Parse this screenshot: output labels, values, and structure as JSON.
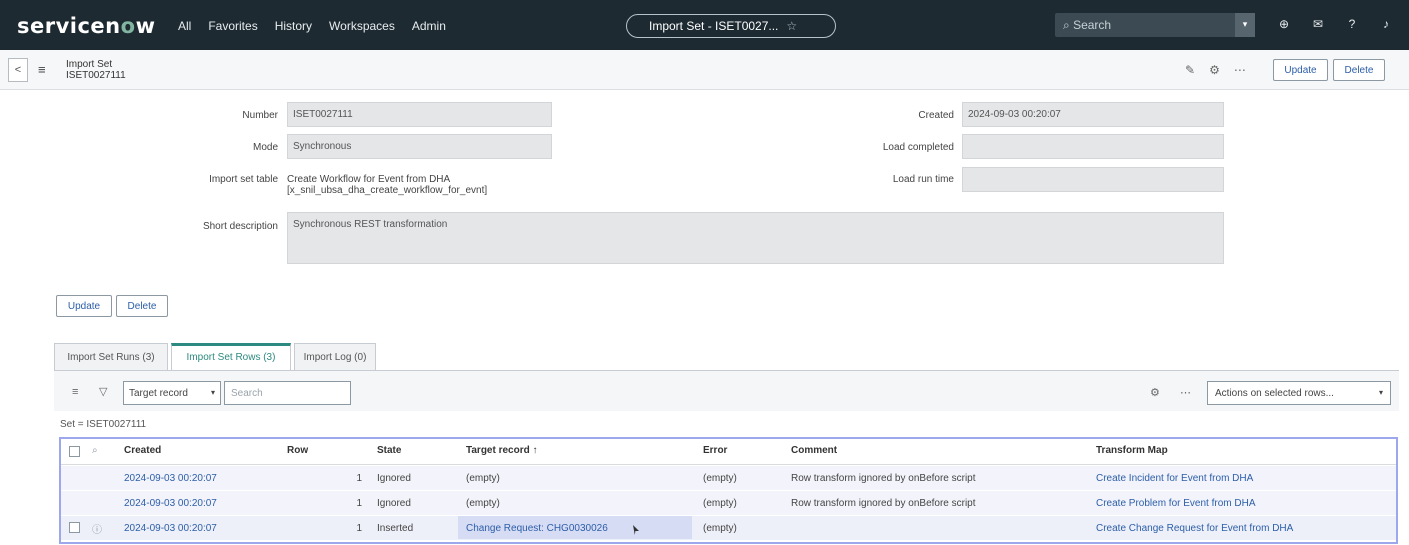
{
  "topnav": {
    "logo_prefix": "servicen",
    "logo_o": "o",
    "logo_suffix": "w",
    "links": [
      "All",
      "Favorites",
      "History",
      "Workspaces",
      "Admin"
    ],
    "pill_title": "Import Set - ISET0027...",
    "pill_star": "☆",
    "search_placeholder": "Search",
    "icons": [
      "globe-icon",
      "chat-icon",
      "help-icon",
      "bell-icon"
    ]
  },
  "header": {
    "title_line1": "Import Set",
    "title_line2": "ISET0027111",
    "update_label": "Update",
    "delete_label": "Delete",
    "icons": [
      "paperclip-icon",
      "settings-icon",
      "more-icon"
    ]
  },
  "form": {
    "number_label": "Number",
    "number_value": "ISET0027111",
    "mode_label": "Mode",
    "mode_value": "Synchronous",
    "import_set_table_label": "Import set table",
    "import_set_table_line1": "Create Workflow for Event from DHA",
    "import_set_table_line2": "[x_snil_ubsa_dha_create_workflow_for_evnt]",
    "short_description_label": "Short description",
    "short_description_value": "Synchronous REST transformation",
    "created_label": "Created",
    "created_value": "2024-09-03 00:20:07",
    "load_completed_label": "Load completed",
    "load_completed_value": "",
    "load_run_time_label": "Load run time",
    "load_run_time_value": ""
  },
  "form_buttons": {
    "update_label": "Update",
    "delete_label": "Delete"
  },
  "tabs": [
    {
      "label": "Import Set Runs (3)"
    },
    {
      "label": "Import Set Rows (3)"
    },
    {
      "label": "Import Log (0)"
    }
  ],
  "list": {
    "search_field": "Target record",
    "search_placeholder": "Search",
    "actions_label": "Actions on selected rows...",
    "breadcrumb": "Set = ISET0027111",
    "columns": [
      "Created",
      "Row",
      "State",
      "Target record ↑",
      "Error",
      "Comment",
      "Transform Map"
    ],
    "rows": [
      {
        "created": "2024-09-03 00:20:07",
        "row": "1",
        "state": "Ignored",
        "target": "(empty)",
        "error": "(empty)",
        "comment": "Row transform ignored by onBefore script",
        "map": "Create Incident for Event from DHA"
      },
      {
        "created": "2024-09-03 00:20:07",
        "row": "1",
        "state": "Ignored",
        "target": "(empty)",
        "error": "(empty)",
        "comment": "Row transform ignored by onBefore script",
        "map": "Create Problem for Event from DHA"
      },
      {
        "created": "2024-09-03 00:20:07",
        "row": "1",
        "state": "Inserted",
        "target": "Change Request: CHG0030026",
        "error": "(empty)",
        "comment": "",
        "map": "Create Change Request for Event from DHA"
      }
    ]
  },
  "colors": {
    "nav_bg": "#1d2a31",
    "accent": "#81b5a1",
    "link": "#2c5ea8",
    "tab_active": "#2c8a80"
  }
}
